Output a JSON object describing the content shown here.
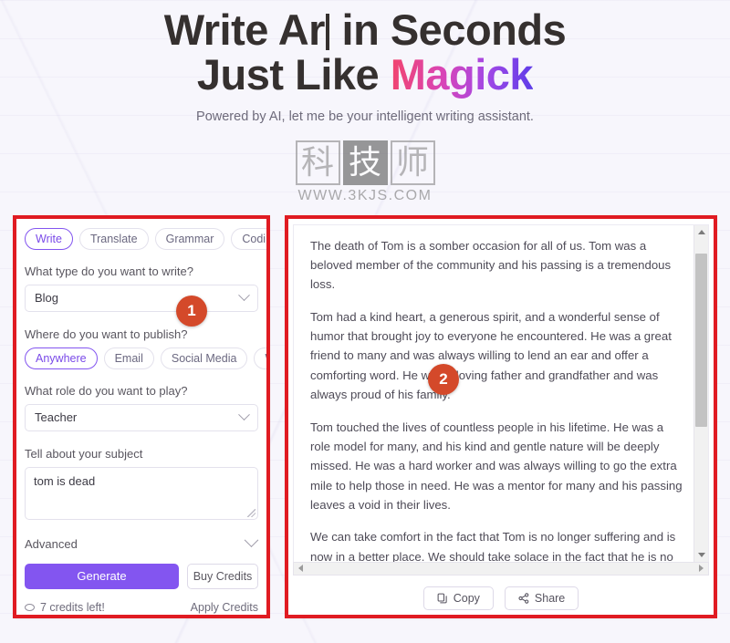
{
  "hero": {
    "headline_part1": "Write Ar",
    "headline_part2": " in Seconds",
    "headline_line2_prefix": "Just Like ",
    "headline_brand": "Magick",
    "subtitle": "Powered by AI, let me be your intelligent writing assistant.",
    "brand_gradient_start": "#f2456c",
    "brand_gradient_end": "#5b3ce8"
  },
  "watermark": {
    "char1": "科",
    "char2": "技",
    "char3": "师",
    "url": "WWW.3KJS.COM"
  },
  "annotations": {
    "badge_color": "#d4492a",
    "box_color": "#e01b22",
    "items": [
      {
        "number": "1",
        "target": "form-panel"
      },
      {
        "number": "2",
        "target": "output-panel"
      }
    ]
  },
  "form_panel": {
    "mode_tabs": [
      {
        "label": "Write",
        "active": true
      },
      {
        "label": "Translate",
        "active": false
      },
      {
        "label": "Grammar",
        "active": false
      },
      {
        "label": "Coding",
        "active": false
      }
    ],
    "type_label": "What type do you want to write?",
    "type_value": "Blog",
    "publish_label": "Where do you want to publish?",
    "publish_options": [
      {
        "label": "Anywhere",
        "active": true
      },
      {
        "label": "Email",
        "active": false
      },
      {
        "label": "Social Media",
        "active": false
      },
      {
        "label": "Work",
        "active": false
      }
    ],
    "role_label": "What role do you want to play?",
    "role_value": "Teacher",
    "subject_label": "Tell about your subject",
    "subject_value": "tom is dead",
    "advanced_label": "Advanced",
    "generate_label": "Generate",
    "buy_credits_label": "Buy Credits",
    "credits_text": "7 credits left!",
    "apply_credits_label": "Apply Credits",
    "accent_color": "#8355f0"
  },
  "output_panel": {
    "paragraphs": [
      "The death of Tom is a somber occasion for all of us. Tom was a beloved member of the community and his passing is a tremendous loss.",
      "Tom had a kind heart, a generous spirit, and a wonderful sense of humor that brought joy to everyone he encountered. He was a great friend to many and was always willing to lend an ear and offer a comforting word. He was a loving father and grandfather and was always proud of his family.",
      "Tom touched the lives of countless people in his lifetime. He was a role model for many, and his kind and gentle nature will be deeply missed. He was a hard worker and was always willing to go the extra mile to help those in need. He was a mentor for many and his passing leaves a void in their lives.",
      "We can take comfort in the fact that Tom is no longer suffering and is now in a better place. We should take solace in the fact that he is no longer in pain and can now rest peacefully."
    ],
    "copy_label": "Copy",
    "share_label": "Share"
  }
}
